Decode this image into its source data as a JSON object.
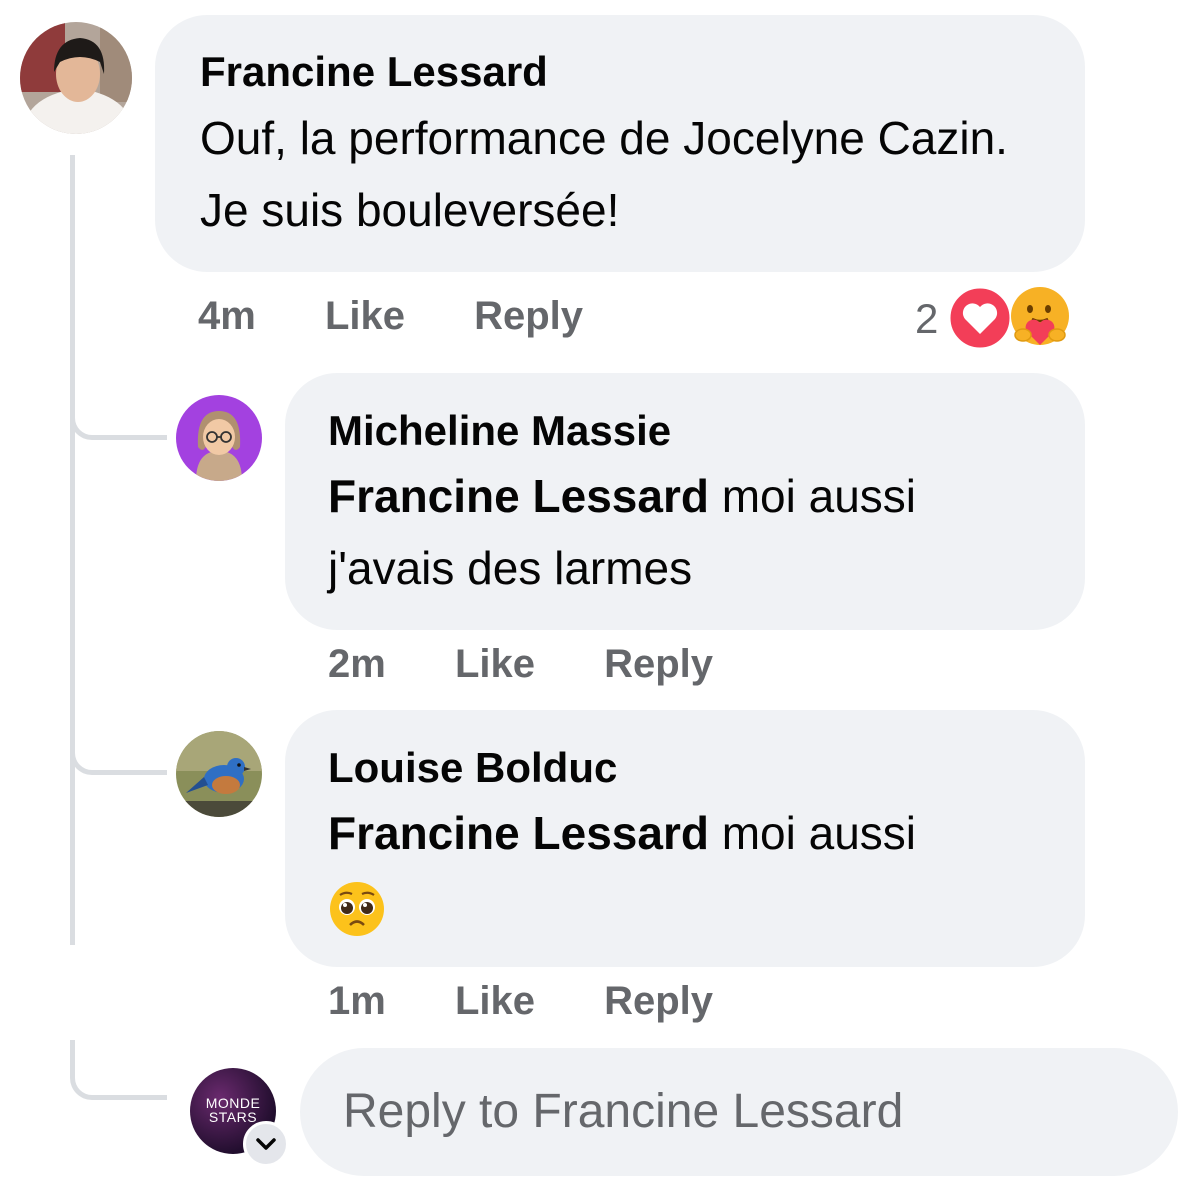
{
  "comment": {
    "author": "Francine Lessard",
    "text": "Ouf, la performance de Jocelyne Cazin. Je suis bouleversée!",
    "time": "4m",
    "like_label": "Like",
    "reply_label": "Reply",
    "reaction_count": "2",
    "reactions": [
      "heart-reaction-icon",
      "care-reaction-icon"
    ]
  },
  "replies": [
    {
      "author": "Micheline Massie",
      "mention": "Francine Lessard",
      "text": " moi aussi j'avais des larmes",
      "time": "2m",
      "like_label": "Like",
      "reply_label": "Reply"
    },
    {
      "author": "Louise Bolduc",
      "mention": "Francine Lessard",
      "text": " moi aussi",
      "emoji": "pleading-face-emoji",
      "time": "1m",
      "like_label": "Like",
      "reply_label": "Reply"
    }
  ],
  "composer": {
    "placeholder": "Reply to Francine Lessard",
    "avatar_text_line1": "MONDE",
    "avatar_text_line2": "STARS"
  },
  "colors": {
    "bubble": "#f0f2f5",
    "meta_text": "#65676b",
    "heart_red": "#f33e58",
    "care_yellow": "#f7b125"
  }
}
